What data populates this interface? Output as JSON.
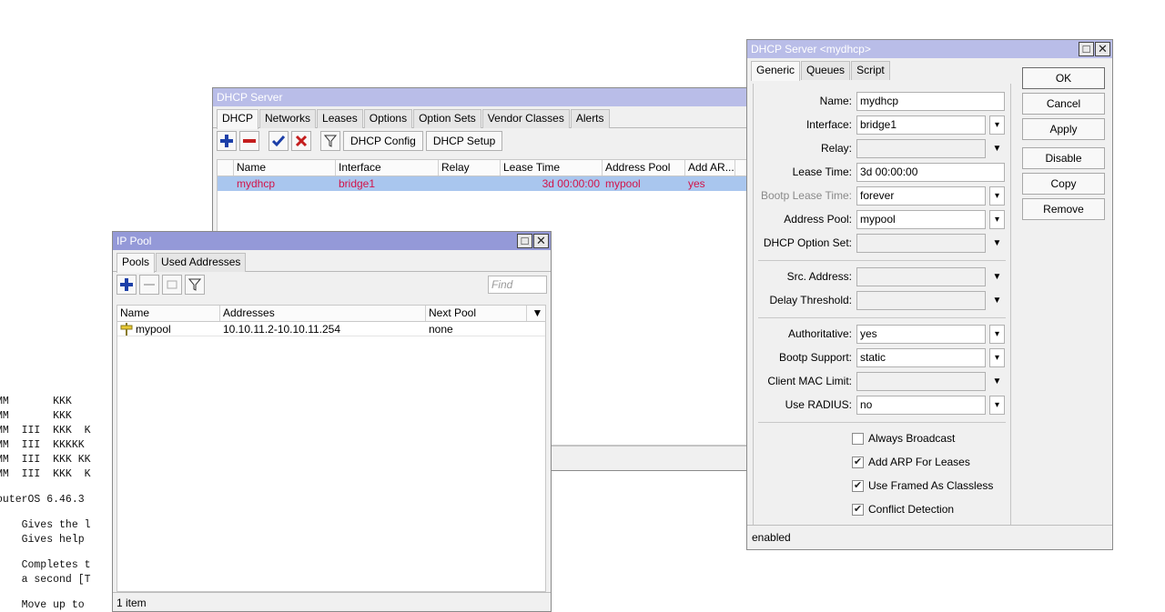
{
  "terminal": {
    "lines": [
      "MM       KKK",
      "MM       KKK",
      "MM  III  KKK  K",
      "MM  III  KKKKK",
      "MM  III  KKK KK",
      "MM  III  KKK  K",
      "",
      "outerOS 6.46.3",
      "",
      "    Gives the l",
      "    Gives help",
      "",
      "    Completes t",
      "    a second [T",
      "",
      "    Move up to"
    ]
  },
  "dhcp_list": {
    "title": "DHCP Server",
    "tabs": [
      "DHCP",
      "Networks",
      "Leases",
      "Options",
      "Option Sets",
      "Vendor Classes",
      "Alerts"
    ],
    "toolbar": {
      "config_label": "DHCP Config",
      "setup_label": "DHCP Setup"
    },
    "columns": [
      "Name",
      "Interface",
      "Relay",
      "Lease Time",
      "Address Pool",
      "Add AR..."
    ],
    "rows": [
      {
        "name": "mydhcp",
        "interface": "bridge1",
        "relay": "",
        "lease_time": "3d 00:00:00",
        "address_pool": "mypool",
        "add_arp": "yes"
      }
    ]
  },
  "ip_pool": {
    "title": "IP Pool",
    "tabs": [
      "Pools",
      "Used Addresses"
    ],
    "find_placeholder": "Find",
    "columns": [
      "Name",
      "Addresses",
      "Next Pool"
    ],
    "rows": [
      {
        "name": "mypool",
        "addresses": "10.10.11.2-10.10.11.254",
        "next_pool": "none"
      }
    ],
    "status": "1 item"
  },
  "dhcp_dialog": {
    "title": "DHCP Server <mydhcp>",
    "tabs": [
      "Generic",
      "Queues",
      "Script"
    ],
    "fields": {
      "name": {
        "label": "Name:",
        "value": "mydhcp"
      },
      "interface": {
        "label": "Interface:",
        "value": "bridge1"
      },
      "relay": {
        "label": "Relay:",
        "value": ""
      },
      "lease_time": {
        "label": "Lease Time:",
        "value": "3d 00:00:00"
      },
      "bootp_lease_time": {
        "label": "Bootp Lease Time:",
        "value": "forever"
      },
      "address_pool": {
        "label": "Address Pool:",
        "value": "mypool"
      },
      "dhcp_option_set": {
        "label": "DHCP Option Set:",
        "value": ""
      },
      "src_address": {
        "label": "Src. Address:",
        "value": ""
      },
      "delay_threshold": {
        "label": "Delay Threshold:",
        "value": ""
      },
      "authoritative": {
        "label": "Authoritative:",
        "value": "yes"
      },
      "bootp_support": {
        "label": "Bootp Support:",
        "value": "static"
      },
      "client_mac_limit": {
        "label": "Client MAC Limit:",
        "value": ""
      },
      "use_radius": {
        "label": "Use RADIUS:",
        "value": "no"
      }
    },
    "checkboxes": [
      {
        "label": "Always Broadcast",
        "checked": false
      },
      {
        "label": "Add ARP For Leases",
        "checked": true
      },
      {
        "label": "Use Framed As Classless",
        "checked": true
      },
      {
        "label": "Conflict Detection",
        "checked": true
      }
    ],
    "buttons": {
      "ok": "OK",
      "cancel": "Cancel",
      "apply": "Apply",
      "disable": "Disable",
      "copy": "Copy",
      "remove": "Remove"
    },
    "status": "enabled"
  },
  "colors": {
    "selected_row_bg": "#a9c6ee",
    "selected_row_text": "#d2144a",
    "title_active": "#9499d8",
    "title_inactive": "#b9bde8",
    "add_icon": "#1c3fa8",
    "remove_icon": "#c41e1e"
  },
  "icons": [
    "plus-icon",
    "minus-icon",
    "check-icon",
    "x-icon",
    "filter-icon",
    "copy-icon",
    "dropdown-arrow-icon",
    "combo-arrow-icon",
    "pool-item-icon"
  ]
}
